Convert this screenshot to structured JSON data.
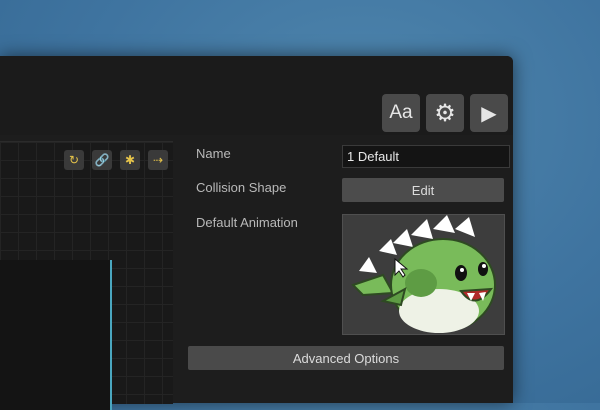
{
  "toolbar": {
    "font_label": "Aa",
    "settings_icon": "gear-icon",
    "play_icon": "play-icon"
  },
  "canvas": {
    "tools": [
      {
        "icon": "rotate-icon"
      },
      {
        "icon": "link-icon"
      },
      {
        "icon": "bug-icon"
      },
      {
        "icon": "arrow-right-icon"
      }
    ]
  },
  "properties": {
    "name_label": "Name",
    "name_value": "1 Default",
    "collision_label": "Collision Shape",
    "edit_label": "Edit",
    "animation_label": "Default Animation",
    "advanced_label": "Advanced Options"
  },
  "colors": {
    "accent": "#4aa7c0",
    "icon_yellow": "#e5c34a",
    "dragon_green": "#79bb5a"
  }
}
